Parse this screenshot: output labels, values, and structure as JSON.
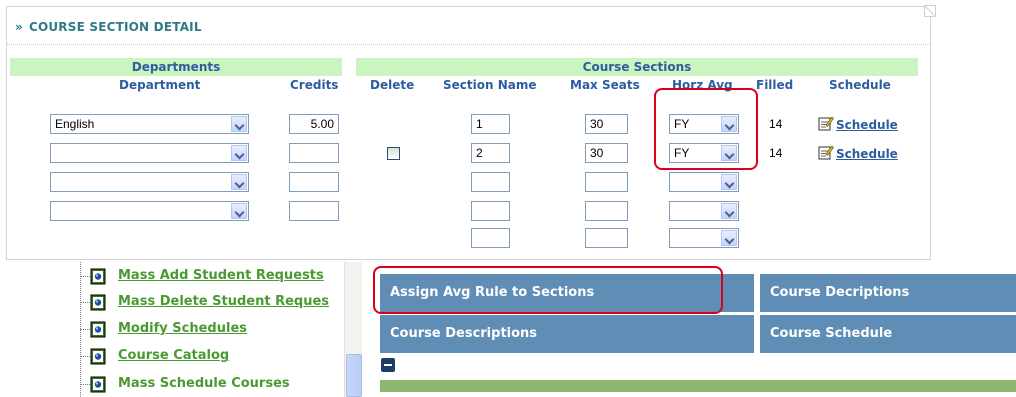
{
  "panel": {
    "title_prefix": "»",
    "title": "COURSE SECTION DETAIL"
  },
  "groups": {
    "departments": "Departments",
    "course_sections": "Course Sections"
  },
  "columns": {
    "department": "Department",
    "credits": "Credits",
    "delete": "Delete",
    "section_name": "Section Name",
    "max_seats": "Max Seats",
    "horz_avg": "Horz Avg",
    "filled": "Filled",
    "schedule": "Schedule"
  },
  "department_rows": [
    {
      "department": "English",
      "credits": "5.00"
    },
    {
      "department": "",
      "credits": ""
    },
    {
      "department": "",
      "credits": ""
    },
    {
      "department": "",
      "credits": ""
    }
  ],
  "section_rows": [
    {
      "delete_checkbox": false,
      "section_name": "1",
      "max_seats": "30",
      "horz_avg": "FY",
      "filled": "14",
      "schedule_link": "Schedule"
    },
    {
      "delete_checkbox": true,
      "section_name": "2",
      "max_seats": "30",
      "horz_avg": "FY",
      "filled": "14",
      "schedule_link": "Schedule"
    },
    {
      "delete_checkbox": false,
      "section_name": "",
      "max_seats": "",
      "horz_avg": ""
    },
    {
      "delete_checkbox": false,
      "section_name": "",
      "max_seats": "",
      "horz_avg": ""
    },
    {
      "delete_checkbox": false,
      "section_name": "",
      "max_seats": "",
      "horz_avg": ""
    }
  ],
  "tree_items": [
    {
      "label": "Mass Add Student Requests"
    },
    {
      "label": "Mass Delete Student Reques"
    },
    {
      "label": "Modify Schedules"
    },
    {
      "label": "Course Catalog"
    },
    {
      "label": "Mass Schedule Courses"
    }
  ],
  "tiles": {
    "assign_avg": "Assign Avg Rule to Sections",
    "course_decriptions": "Course Decriptions",
    "course_descriptions": "Course Descriptions",
    "course_schedule": "Course Schedule"
  },
  "colors": {
    "header_text": "#2c5d9e",
    "title_text": "#2f7a86",
    "group_bar": "#ccf4c0",
    "highlight": "#d9001b",
    "tile": "#5f8db5",
    "tree_link": "#4a9a32",
    "strip": "#8db56d"
  },
  "icons": {
    "schedule": "edit-note-icon",
    "tree": "document-icon",
    "collapse": "minus-icon"
  }
}
